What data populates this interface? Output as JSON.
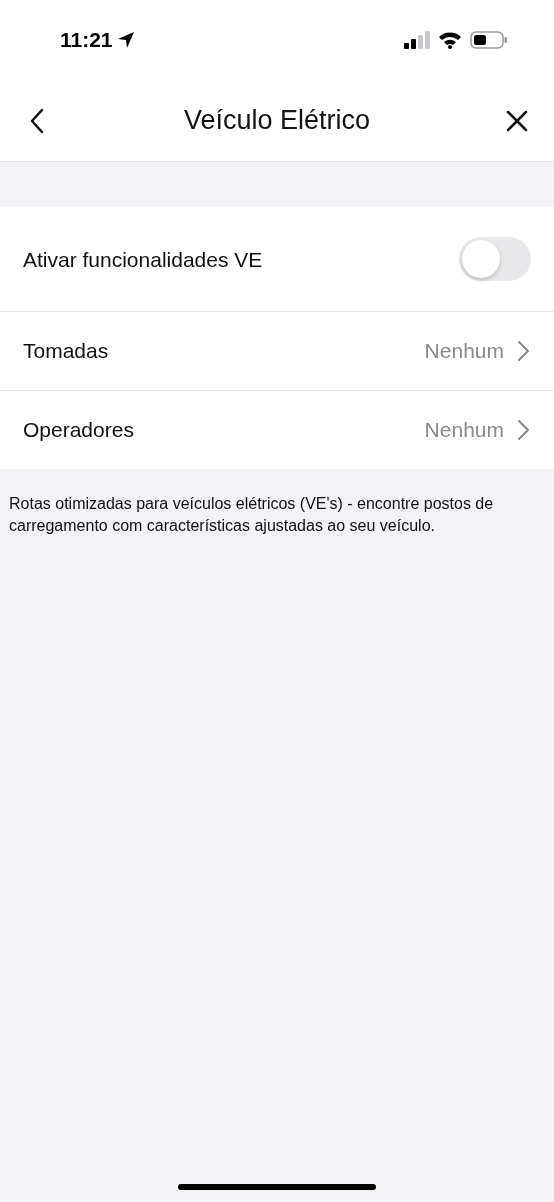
{
  "status_bar": {
    "time": "11:21"
  },
  "nav": {
    "title": "Veículo Elétrico"
  },
  "settings": [
    {
      "kind": "toggle",
      "label": "Ativar funcionalidades VE",
      "on": false
    },
    {
      "kind": "link",
      "label": "Tomadas",
      "value": "Nenhum"
    },
    {
      "kind": "link",
      "label": "Operadores",
      "value": "Nenhum"
    }
  ],
  "footer": "Rotas otimizadas para veículos elétricos (VE's) - encontre postos de carregamento com características ajustadas ao seu veículo."
}
